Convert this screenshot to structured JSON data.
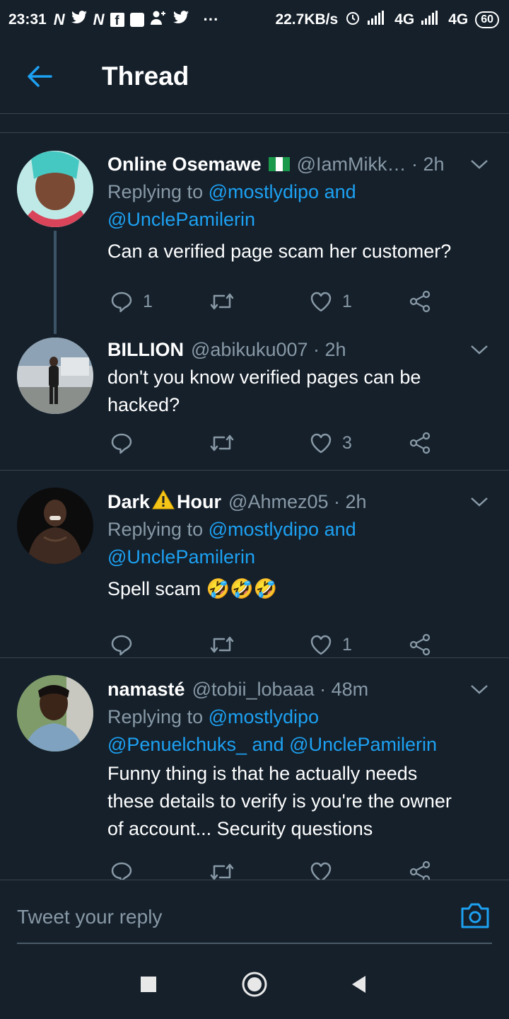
{
  "status_bar": {
    "time": "23:31",
    "notif_icons": [
      "N",
      "𝐘",
      "N",
      "f",
      "■",
      "☺",
      "𝐘",
      "···"
    ],
    "speed": "22.7KB/s",
    "network1": "4G",
    "network2": "4G",
    "battery": "60"
  },
  "header": {
    "title": "Thread"
  },
  "tweets": [
    {
      "display_name": "Online Osemawe",
      "handle": "@IamMikk… · 2h",
      "reply_prefix": "Replying to",
      "reply_mentions": "@mostlydipo and @UnclePamilerin",
      "reply_line1_mention": "@mostlydipo and",
      "reply_line2": "@UnclePamilerin",
      "text": "Can a verified page scam her customer?",
      "reply_count": "1",
      "like_count": "1",
      "avatar_color": "#7fd4d0"
    },
    {
      "display_name": "BILLION",
      "handle": "@abikuku007 · 2h",
      "text_line1": "don't you know verified pages can be",
      "text_line2": "hacked?",
      "reply_count": "",
      "like_count": "3",
      "avatar_color": "#9aa6a8"
    },
    {
      "display_name": "Dark",
      "display_name_2": "Hour",
      "handle": "@Ahmez05 · 2h",
      "reply_prefix": "Replying to",
      "reply_line1_mention": "@mostlydipo and",
      "reply_line2": "@UnclePamilerin",
      "text": "Spell scam",
      "emoji": "🤣🤣🤣",
      "reply_count": "",
      "like_count": "1",
      "avatar_color": "#1a1a1a"
    },
    {
      "display_name": "namasté",
      "handle": "@tobii_lobaaa · 48m",
      "reply_prefix": "Replying to",
      "reply_line1_mention": "@mostlydipo",
      "reply_line2": "@Penuelchuks_ and @UnclePamilerin",
      "text_line1": "Funny thing is that he actually needs",
      "text_line2": "these details to verify is you're the owner",
      "text_line3": "of account... Security questions",
      "avatar_color": "#6a8a5a"
    }
  ],
  "reply_bar": {
    "placeholder": "Tweet your reply"
  },
  "colors": {
    "background": "#15202b",
    "accent": "#1da1f2",
    "muted": "#8899a6",
    "divider": "#38444d"
  }
}
